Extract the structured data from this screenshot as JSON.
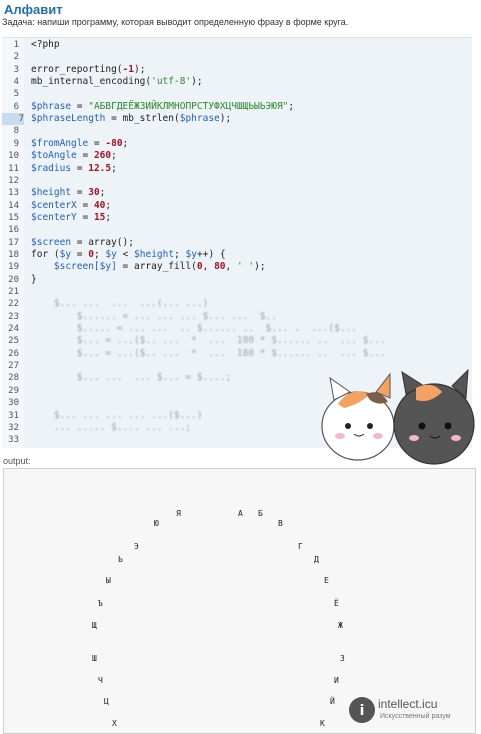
{
  "page": {
    "title": "Алфавит",
    "task": "Задача: напиши программу, которая выводит определенную фразу в форме круга."
  },
  "editor": {
    "highlighted_line": 7,
    "lines": [
      {
        "n": "1",
        "t": "<?php"
      },
      {
        "n": "2",
        "t": ""
      },
      {
        "n": "3",
        "t": "error_reporting(-1);"
      },
      {
        "n": "4",
        "t": "mb_internal_encoding('utf-8');"
      },
      {
        "n": "5",
        "t": ""
      },
      {
        "n": "6",
        "t": "$phrase = \"АБВГДЕЁЖЗИЙКЛМНОПРСТУФХЦЧШЩЬЫЬЭЮЯ\";"
      },
      {
        "n": "7",
        "t": "$phraseLength = mb_strlen($phrase);"
      },
      {
        "n": "8",
        "t": ""
      },
      {
        "n": "9",
        "t": "$fromAngle = -80;"
      },
      {
        "n": "10",
        "t": "$toAngle = 260;"
      },
      {
        "n": "11",
        "t": "$radius = 12.5;"
      },
      {
        "n": "12",
        "t": ""
      },
      {
        "n": "13",
        "t": "$height = 30;"
      },
      {
        "n": "14",
        "t": "$centerX = 40;"
      },
      {
        "n": "15",
        "t": "$centerY = 15;"
      },
      {
        "n": "16",
        "t": ""
      },
      {
        "n": "17",
        "t": "$screen = array();"
      },
      {
        "n": "18",
        "t": "for ($y = 0; $y < $height; $y++) {"
      },
      {
        "n": "19",
        "t": "    $screen[$y] = array_fill(0, 80, ' ');"
      },
      {
        "n": "20",
        "t": "}"
      },
      {
        "n": "21",
        "t": ""
      },
      {
        "n": "22",
        "t": "    $... ...  ...  ...(... ...)"
      },
      {
        "n": "23",
        "t": "        $...... = ... ... ... $... ...  $.."
      },
      {
        "n": "24",
        "t": "        $..... = ... ...  .. $...... ..  $... .  ...($..."
      },
      {
        "n": "25",
        "t": "        $... = ...($.. ...  *  ...  180 * $...... ..  ... $..."
      },
      {
        "n": "26",
        "t": "        $... = ...($.. ...  *  ...  180 * $...... ..  ... $..."
      },
      {
        "n": "27",
        "t": ""
      },
      {
        "n": "28",
        "t": "        $... ...  ... $... = $....;"
      },
      {
        "n": "29",
        "t": ""
      },
      {
        "n": "30",
        "t": ""
      },
      {
        "n": "31",
        "t": "    $... ... ... ... ...($...)"
      },
      {
        "n": "32",
        "t": "    ... ..... $.... ... ...;"
      },
      {
        "n": "33",
        "t": ""
      }
    ]
  },
  "output": {
    "label": "output:",
    "chars": [
      "Я",
      "А",
      "Б",
      "Ю",
      "В",
      "Э",
      "Г",
      "Ь",
      "Д",
      "Ы",
      "Е",
      "Ъ",
      "Ё",
      "Щ",
      "Ж",
      "Ш",
      "З",
      "Ч",
      "И",
      "Ц",
      "Й",
      "Х",
      "К"
    ]
  },
  "watermark": {
    "title": "intellect.icu",
    "subtitle": "Искусственный разум"
  },
  "colors": {
    "title": "#1f6fb5",
    "variable": "#1e60c2",
    "string": "#2c8a2c",
    "number": "#aa1122"
  },
  "icons": {
    "decoration": "cats-illustration",
    "watermark": "intellect-logo-icon"
  }
}
